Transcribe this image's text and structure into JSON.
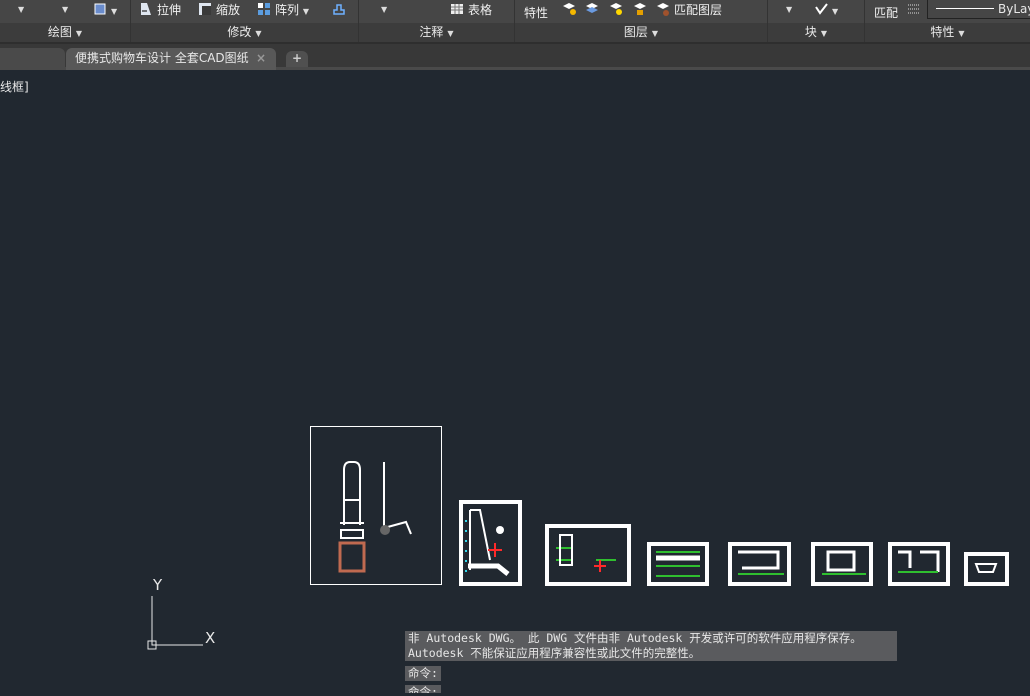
{
  "ribbon": {
    "panels": [
      {
        "label": "绘图"
      },
      {
        "label": "修改"
      },
      {
        "label": "注释"
      },
      {
        "label": "图层"
      },
      {
        "label": "块"
      },
      {
        "label": "特性"
      }
    ],
    "modify_tools": {
      "stretch": "拉伸",
      "scale": "缩放",
      "array": "阵列"
    },
    "annotation_tools": {
      "table": "表格"
    },
    "layer_tools": {
      "properties": "特性",
      "match_layer": "匹配图层"
    },
    "properties_tools": {
      "match": "匹配",
      "linetype": "ByLayer"
    }
  },
  "tabs": [
    {
      "label": "便携式购物车设计 全套CAD图纸",
      "active": true
    }
  ],
  "tab_close": "×",
  "tab_add": "+",
  "viewport": {
    "label": "线框]"
  },
  "ucs": {
    "x": "X",
    "y": "Y"
  },
  "command": {
    "history": [
      "非 Autodesk DWG。  此 DWG 文件由非 Autodesk 开发或许可的软件应用程序保存。",
      "Autodesk 不能保证应用程序兼容性或此文件的完整性。"
    ],
    "prompt": "命令:"
  },
  "colors": {
    "canvas": "#212830",
    "ribbon": "#464646",
    "accent_red": "#ff2a2a",
    "accent_green": "#2fbf2f",
    "accent_cyan": "#33d6e8"
  }
}
